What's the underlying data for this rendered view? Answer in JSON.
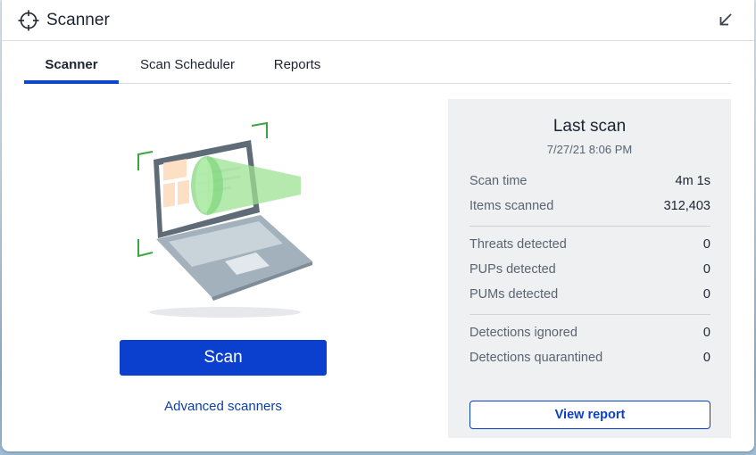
{
  "window": {
    "title": "Scanner"
  },
  "tabs": [
    {
      "label": "Scanner",
      "active": true
    },
    {
      "label": "Scan Scheduler",
      "active": false
    },
    {
      "label": "Reports",
      "active": false
    }
  ],
  "scanner": {
    "scan_label": "Scan",
    "advanced_label": "Advanced scanners"
  },
  "last_scan": {
    "title": "Last scan",
    "date": "7/27/21 8:06 PM",
    "group1": [
      {
        "label": "Scan time",
        "value": "4m 1s"
      },
      {
        "label": "Items scanned",
        "value": "312,403"
      }
    ],
    "group2": [
      {
        "label": "Threats detected",
        "value": "0"
      },
      {
        "label": "PUPs detected",
        "value": "0"
      },
      {
        "label": "PUMs detected",
        "value": "0"
      }
    ],
    "group3": [
      {
        "label": "Detections ignored",
        "value": "0"
      },
      {
        "label": "Detections quarantined",
        "value": "0"
      }
    ],
    "view_report_label": "View report"
  },
  "icons": {
    "title": "crosshair-icon",
    "collapse": "arrow-down-left-icon"
  },
  "colors": {
    "accent": "#0b3fce",
    "link": "#0d3ea8",
    "scan_beam": "#7fd67a",
    "card_bg": "#eef0f2"
  }
}
